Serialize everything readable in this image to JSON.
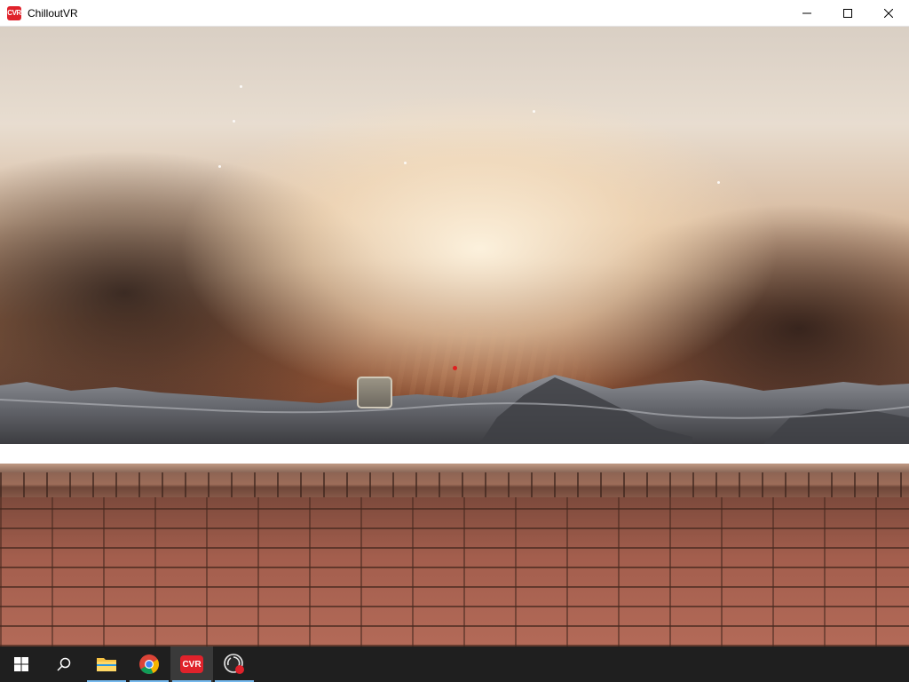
{
  "window": {
    "title": "ChilloutVR",
    "app_icon_text": "CVR",
    "controls": [
      "minimize-icon",
      "maximize-icon",
      "close-icon"
    ]
  },
  "scene": {
    "description_icons": [
      "crosshair-dot",
      "menu-panel-box"
    ]
  },
  "taskbar": {
    "items": [
      {
        "name": "start-button",
        "icon": "windows-logo-icon",
        "active": false
      },
      {
        "name": "search-button",
        "icon": "search-icon",
        "active": false
      },
      {
        "name": "file-explorer",
        "icon": "folder-icon",
        "active": false,
        "running": true
      },
      {
        "name": "chrome",
        "icon": "chrome-icon",
        "active": false,
        "running": true
      },
      {
        "name": "chilloutvr",
        "icon": "cvr-icon",
        "label": "CVR",
        "active": true,
        "running": true
      },
      {
        "name": "obs",
        "icon": "recording-icon",
        "active": false,
        "running": true
      }
    ]
  },
  "colors": {
    "accent": "#76b9ed",
    "cvr_red": "#e0222b",
    "taskbar_bg": "#1f1f1f"
  }
}
